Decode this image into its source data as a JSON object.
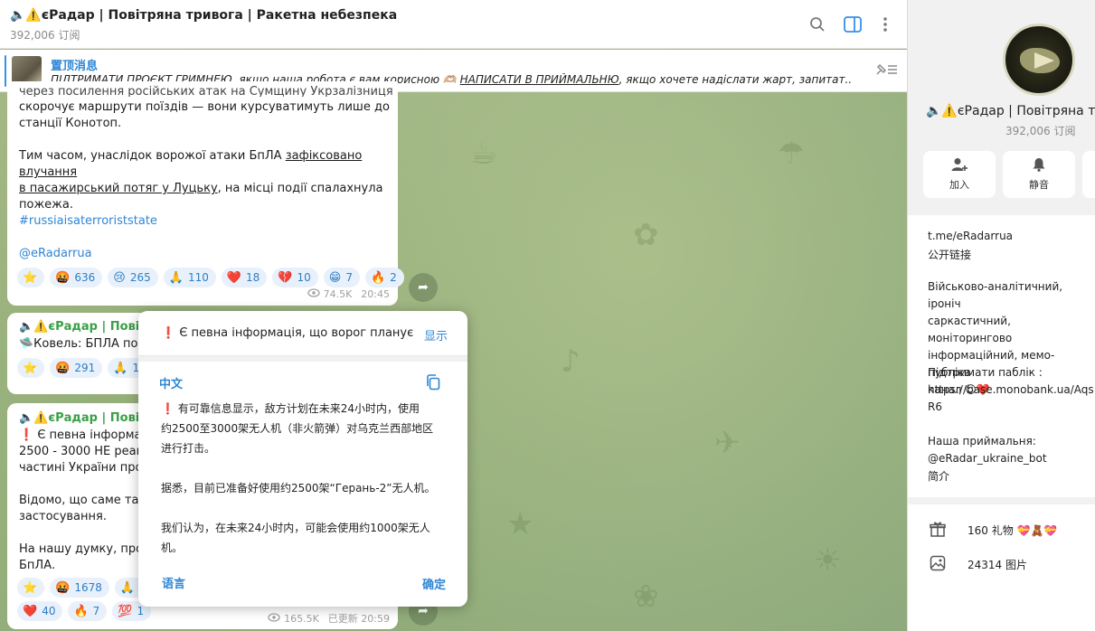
{
  "header": {
    "title": "🔈⚠️єРадар | Повітряна тривога | Ракетна небезпека",
    "subscribers": "392,006 订阅"
  },
  "pinned": {
    "label": "置顶消息",
    "text_a": "ПІДТРИМАТИ ПРОЄКТ ГРИМНЕЮ",
    "text_b": ", якщо наша робота є вам корисною 🫶🏼   ",
    "text_c": "НАПИСАТИ В ПРИЙМАЛЬНЮ",
    "text_d": ", якщо хочете надіслати жарт, запитат..."
  },
  "messages": {
    "m1": {
      "line_top": "через посилення російських атак на Сумщину Укрзалізниця",
      "text_a": "скорочує маршрути поїздів — вони курсуватимуть лише до\nстанції Конотоп.\n\nТим часом, унаслідок ворожої атаки БпЛА ",
      "link_a": "зафіксовано влучання",
      "link_b": "в пасажирський потяг у Луцьку",
      "text_b": ", на місці події спалахнула\nпожежа.",
      "hashtag": "#russiaisaterroriststate",
      "mention": "@eRadarrua",
      "reactions": [
        {
          "emoji": "⭐",
          "count": ""
        },
        {
          "emoji": "🤬",
          "count": "636"
        },
        {
          "emoji": "😢",
          "count": "265"
        },
        {
          "emoji": "🙏",
          "count": "110"
        },
        {
          "emoji": "❤️",
          "count": "18"
        },
        {
          "emoji": "💔",
          "count": "10"
        },
        {
          "emoji": "😁",
          "count": "7"
        },
        {
          "emoji": "🔥",
          "count": "2"
        }
      ],
      "views": "74.5K",
      "time": "20:45"
    },
    "m2": {
      "sender": "🔈⚠️єРадар | Пові",
      "text": "🛸Ковель: БПЛА пове",
      "reactions": [
        {
          "emoji": "⭐",
          "count": ""
        },
        {
          "emoji": "🤬",
          "count": "291"
        },
        {
          "emoji": "🙏",
          "count": "178"
        }
      ]
    },
    "m3": {
      "sender": "🔈⚠️єРадар | Пові",
      "text": "❗ Є певна інформац\n2500 - 3000 НЕ реакти\nчастині України прот\n\nВідомо, що саме така\nзастосування.\n\nНа нашу думку, прот\nБпЛА.",
      "reactions_row1": [
        {
          "emoji": "⭐",
          "count": ""
        },
        {
          "emoji": "🤬",
          "count": "1678"
        },
        {
          "emoji": "🙏",
          "count": "38"
        }
      ],
      "reactions_row2": [
        {
          "emoji": "❤️",
          "count": "40"
        },
        {
          "emoji": "🔥",
          "count": "7"
        },
        {
          "emoji": "💯",
          "count": "1"
        }
      ],
      "views": "165.5K",
      "time": "已更新 20:59"
    }
  },
  "popup": {
    "original": "❗ Є певна інформація, що ворог планує",
    "show_label": "显示",
    "language": "中文",
    "translation": "❗ 有可靠信息显示，敌方计划在未来24小时内，使用\n约2500至3000架无人机（非火箭弹）对乌克兰西部地区\n进行打击。\n\n据悉，目前已准备好使用约2500架“Герань-2”无人机。\n\n我们认为，在未来24小时内，可能会使用约1000架无人\n机。",
    "language_button": "语言",
    "ok_button": "确定"
  },
  "side": {
    "name": "🔈⚠️єРадар | Повітряна тр",
    "subscribers": "392,006 订阅",
    "join_label": "加入",
    "mute_label": "静音",
    "link": "t.me/eRadarrua",
    "link_label": "公开链接",
    "description": "Військово-аналітичний, іроніч\nсаркастичний, моніторингово\nінформаційний, мемо-публіка\nканал 😉❤️",
    "support_label": "Підтримати паблік :",
    "support_link": "https://base.monobank.ua/Aqs\nR6",
    "reception_label": "Наша приймальня:",
    "reception_bot": "@eRadar_ukraine_bot",
    "bio_label": "简介",
    "gifts": "160 礼物 💝🧸💝",
    "photos": "24314 图片"
  }
}
